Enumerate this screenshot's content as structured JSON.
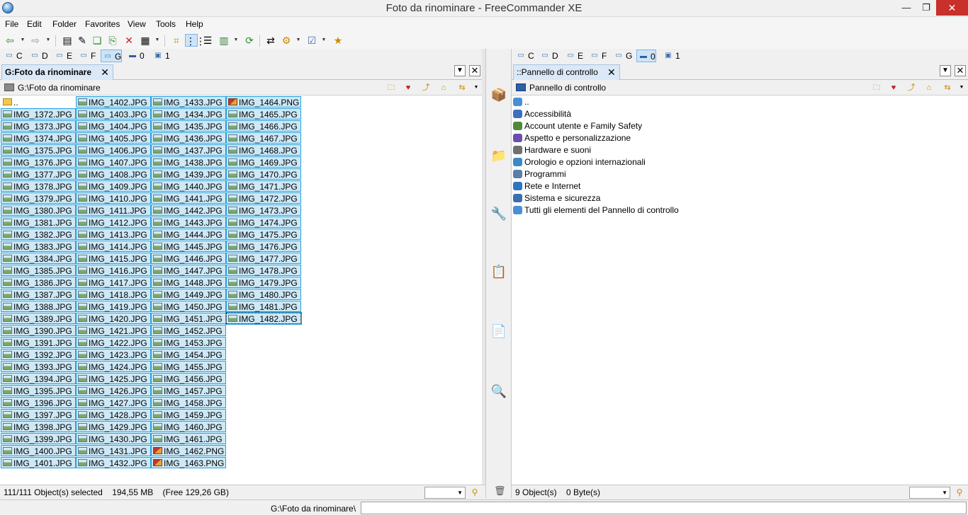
{
  "window": {
    "title": "Foto da rinominare - FreeCommander XE",
    "minimize": "—",
    "maximize": "❐",
    "close": "✕"
  },
  "menu": [
    "File",
    "Edit",
    "Folder",
    "Favorites",
    "View",
    "Tools",
    "Help"
  ],
  "drives_left": [
    {
      "letter": "C",
      "icon": "network-drive-icon"
    },
    {
      "letter": "D",
      "icon": "dvd-drive-icon"
    },
    {
      "letter": "E",
      "icon": "printer-drive-icon"
    },
    {
      "letter": "F",
      "icon": "removable-drive-icon"
    },
    {
      "letter": "G",
      "icon": "usb-drive-icon",
      "active": true
    },
    {
      "letter": "0",
      "icon": "desktop-icon"
    },
    {
      "letter": "1",
      "icon": "computer-icon"
    }
  ],
  "drives_right": [
    {
      "letter": "C",
      "icon": "network-drive-icon"
    },
    {
      "letter": "D",
      "icon": "dvd-drive-icon"
    },
    {
      "letter": "E",
      "icon": "printer-drive-icon"
    },
    {
      "letter": "F",
      "icon": "removable-drive-icon"
    },
    {
      "letter": "G",
      "icon": "usb-drive-icon"
    },
    {
      "letter": "0",
      "icon": "desktop-icon",
      "active": true
    },
    {
      "letter": "1",
      "icon": "computer-icon"
    }
  ],
  "left_panel": {
    "tab": "G:Foto da rinominare",
    "path": "G:\\Foto da rinominare",
    "up_item": "..",
    "files": [
      "IMG_1372.JPG",
      "IMG_1373.JPG",
      "IMG_1374.JPG",
      "IMG_1375.JPG",
      "IMG_1376.JPG",
      "IMG_1377.JPG",
      "IMG_1378.JPG",
      "IMG_1379.JPG",
      "IMG_1380.JPG",
      "IMG_1381.JPG",
      "IMG_1382.JPG",
      "IMG_1383.JPG",
      "IMG_1384.JPG",
      "IMG_1385.JPG",
      "IMG_1386.JPG",
      "IMG_1387.JPG",
      "IMG_1388.JPG",
      "IMG_1389.JPG",
      "IMG_1390.JPG",
      "IMG_1391.JPG",
      "IMG_1392.JPG",
      "IMG_1393.JPG",
      "IMG_1394.JPG",
      "IMG_1395.JPG",
      "IMG_1396.JPG",
      "IMG_1397.JPG",
      "IMG_1398.JPG",
      "IMG_1399.JPG",
      "IMG_1400.JPG",
      "IMG_1401.JPG",
      "IMG_1402.JPG",
      "IMG_1403.JPG",
      "IMG_1404.JPG",
      "IMG_1405.JPG",
      "IMG_1406.JPG",
      "IMG_1407.JPG",
      "IMG_1408.JPG",
      "IMG_1409.JPG",
      "IMG_1410.JPG",
      "IMG_1411.JPG",
      "IMG_1412.JPG",
      "IMG_1413.JPG",
      "IMG_1414.JPG",
      "IMG_1415.JPG",
      "IMG_1416.JPG",
      "IMG_1417.JPG",
      "IMG_1418.JPG",
      "IMG_1419.JPG",
      "IMG_1420.JPG",
      "IMG_1421.JPG",
      "IMG_1422.JPG",
      "IMG_1423.JPG",
      "IMG_1424.JPG",
      "IMG_1425.JPG",
      "IMG_1426.JPG",
      "IMG_1427.JPG",
      "IMG_1428.JPG",
      "IMG_1429.JPG",
      "IMG_1430.JPG",
      "IMG_1431.JPG",
      "IMG_1432.JPG",
      "IMG_1433.JPG",
      "IMG_1434.JPG",
      "IMG_1435.JPG",
      "IMG_1436.JPG",
      "IMG_1437.JPG",
      "IMG_1438.JPG",
      "IMG_1439.JPG",
      "IMG_1440.JPG",
      "IMG_1441.JPG",
      "IMG_1442.JPG",
      "IMG_1443.JPG",
      "IMG_1444.JPG",
      "IMG_1445.JPG",
      "IMG_1446.JPG",
      "IMG_1447.JPG",
      "IMG_1448.JPG",
      "IMG_1449.JPG",
      "IMG_1450.JPG",
      "IMG_1451.JPG",
      "IMG_1452.JPG",
      "IMG_1453.JPG",
      "IMG_1454.JPG",
      "IMG_1455.JPG",
      "IMG_1456.JPG",
      "IMG_1457.JPG",
      "IMG_1458.JPG",
      "IMG_1459.JPG",
      "IMG_1460.JPG",
      "IMG_1461.JPG",
      "IMG_1462.PNG",
      "IMG_1463.PNG",
      "IMG_1464.PNG",
      "IMG_1465.JPG",
      "IMG_1466.JPG",
      "IMG_1467.JPG",
      "IMG_1468.JPG",
      "IMG_1469.JPG",
      "IMG_1470.JPG",
      "IMG_1471.JPG",
      "IMG_1472.JPG",
      "IMG_1473.JPG",
      "IMG_1474.JPG",
      "IMG_1475.JPG",
      "IMG_1476.JPG",
      "IMG_1477.JPG",
      "IMG_1478.JPG",
      "IMG_1479.JPG",
      "IMG_1480.JPG",
      "IMG_1481.JPG",
      "IMG_1482.JPG"
    ],
    "status": "111/111 Object(s) selected    194,55 MB    (Free 129,26 GB)"
  },
  "right_panel": {
    "tab": "::Pannello di controllo",
    "path": "Pannello di controllo",
    "items": [
      {
        "label": "..",
        "icon": "control-panel-up-icon",
        "color": "#4a8fd6"
      },
      {
        "label": "Accessibilità",
        "icon": "accessibility-icon",
        "color": "#3d6fc2"
      },
      {
        "label": "Account utente e Family Safety",
        "icon": "users-icon",
        "color": "#4d8a3a"
      },
      {
        "label": "Aspetto e personalizzazione",
        "icon": "appearance-icon",
        "color": "#6a4fb0"
      },
      {
        "label": "Hardware e suoni",
        "icon": "hardware-icon",
        "color": "#707070"
      },
      {
        "label": "Orologio e opzioni internazionali",
        "icon": "clock-icon",
        "color": "#3a8ac8"
      },
      {
        "label": "Programmi",
        "icon": "programs-icon",
        "color": "#5a7fa8"
      },
      {
        "label": "Rete e Internet",
        "icon": "network-icon",
        "color": "#2e75c4"
      },
      {
        "label": "Sistema e sicurezza",
        "icon": "security-icon",
        "color": "#3a6fb0"
      },
      {
        "label": "Tutti gli elementi del Pannello di controllo",
        "icon": "all-items-icon",
        "color": "#4a8fd6"
      }
    ],
    "status": "9 Object(s)    0 Byte(s)"
  },
  "middle_buttons": [
    {
      "name": "pack-button",
      "icon": "archive-box-icon",
      "glyph": "📦"
    },
    {
      "name": "view-file-button",
      "icon": "folder-view-icon",
      "glyph": "📁"
    },
    {
      "name": "tools-button",
      "icon": "tools-icon",
      "glyph": "🔧"
    },
    {
      "name": "copy-button",
      "icon": "copy-file-icon",
      "glyph": "📋"
    },
    {
      "name": "move-button",
      "icon": "move-file-icon",
      "glyph": "📄"
    },
    {
      "name": "search-button",
      "icon": "search-icon",
      "glyph": "🔍"
    }
  ],
  "command_line": {
    "label": "G:\\Foto da rinominare\\",
    "value": ""
  },
  "colors": {
    "selection_bg": "#cde8f6",
    "selection_border": "#26a0da",
    "close_red": "#c7302b"
  }
}
